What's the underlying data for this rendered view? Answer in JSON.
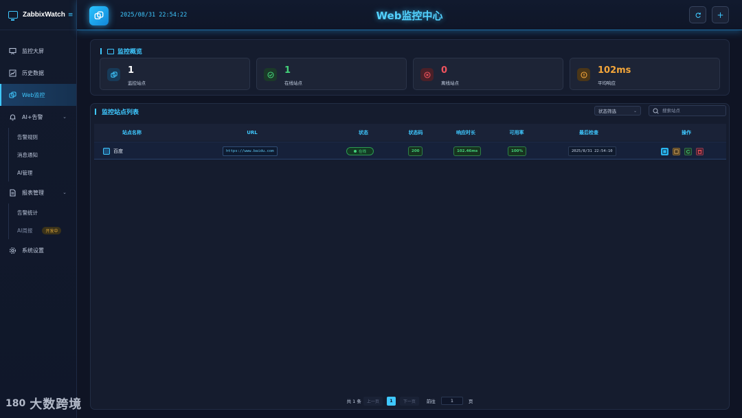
{
  "brand": {
    "name": "ZabbixWatch",
    "collapse_icon": "menu-collapse-icon"
  },
  "sidebar": {
    "items": [
      {
        "label": "监控大屏",
        "icon": "presentation-board-icon"
      },
      {
        "label": "历史数据",
        "icon": "chart-line-icon"
      },
      {
        "label": "Web监控",
        "icon": "link-copy-icon",
        "active": true
      },
      {
        "label": "AI+告警",
        "icon": "bell-icon",
        "expanded": true,
        "children": [
          {
            "label": "告警规则"
          },
          {
            "label": "消息通知"
          },
          {
            "label": "AI管理"
          }
        ]
      },
      {
        "label": "报表管理",
        "icon": "document-icon",
        "expanded": true,
        "children": [
          {
            "label": "告警统计"
          },
          {
            "label": "AI周报",
            "badge": "开发中"
          }
        ]
      },
      {
        "label": "系统设置",
        "icon": "gear-icon"
      }
    ]
  },
  "header": {
    "datetime": "2025/08/31 22:54:22",
    "title": "Web监控中心",
    "buttons": {
      "refresh_icon": "refresh-icon",
      "add_label": "+"
    }
  },
  "overview": {
    "title": "监控概览",
    "stats": [
      {
        "value": "1",
        "label": "监控站点",
        "color": "#ffffff",
        "icon_color": "#3fc8ff",
        "icon_bg": "#173a58"
      },
      {
        "value": "1",
        "label": "在线站点",
        "color": "#44d27a",
        "icon_color": "#44d27a",
        "icon_bg": "#1b3a29"
      },
      {
        "value": "0",
        "label": "离线站点",
        "color": "#f0535e",
        "icon_color": "#f0535e",
        "icon_bg": "#4a2028"
      },
      {
        "value": "102ms",
        "label": "平均响应",
        "color": "#f4a63a",
        "icon_color": "#f4a63a",
        "icon_bg": "#4a3618"
      }
    ]
  },
  "list": {
    "title": "监控站点列表",
    "filter_label": "状态筛选",
    "search_placeholder": "搜索站点",
    "columns": [
      "站点名称",
      "URL",
      "状态",
      "状态码",
      "响应时长",
      "可用率",
      "最后检查",
      "操作"
    ],
    "rows": [
      {
        "name": "百度",
        "url": "https://www.baidu.com",
        "status": "在线",
        "code": "200",
        "response": "102.46ms",
        "availability": "100%",
        "last_check": "2025/8/31 22:54:10"
      }
    ]
  },
  "pagination": {
    "total": "共 1 条",
    "prev": "上一页",
    "page": "1",
    "next": "下一页",
    "goto_label": "前往",
    "goto_value": "1",
    "page_suffix": "页"
  },
  "watermark": {
    "logo": "180",
    "text": "大数跨境"
  },
  "colors": {
    "accent": "#3fc8ff",
    "success": "#44d27a",
    "danger": "#f0535e",
    "warning": "#f4a63a"
  }
}
